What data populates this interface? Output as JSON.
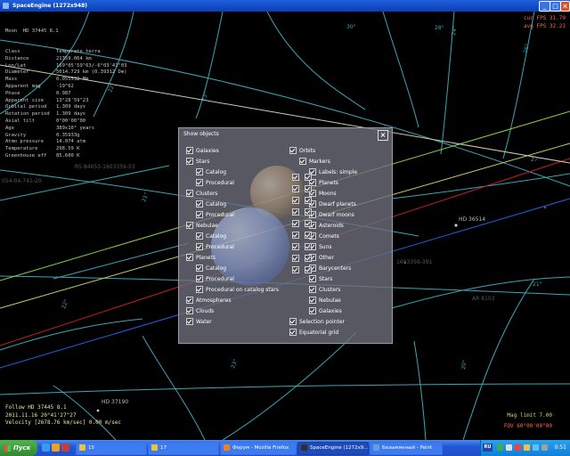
{
  "window": {
    "title": "SpaceEngine (1272x948)",
    "buttons": {
      "minimize": "_",
      "maximize": "□",
      "close": "×"
    }
  },
  "hud": {
    "object": "Moon  HD 37445 8.1",
    "rows": [
      {
        "label": "Class",
        "value": "Temperate terra"
      },
      {
        "label": "Distance",
        "value": "21359.064 km"
      },
      {
        "label": "Lon/Lat",
        "value": "169°05'59\"63/-6°03'41\"03"
      },
      {
        "label": "Diameter",
        "value": "5014.729 km (0.39312 D⊕)"
      },
      {
        "label": "Mass",
        "value": "0.055532 M⊕"
      },
      {
        "label": "Apparent mag",
        "value": "-19^62"
      },
      {
        "label": "Phase",
        "value": "0.987"
      },
      {
        "label": "Apparent size",
        "value": "13°28'59\"23"
      },
      {
        "label": "Orbital period",
        "value": "1.309 days"
      },
      {
        "label": "Rotation period",
        "value": "1.309 days"
      },
      {
        "label": "Axial tilt",
        "value": "0°00'00\"00"
      },
      {
        "label": "Age",
        "value": "389x10⁶ years"
      },
      {
        "label": "Gravity",
        "value": "0.35933g"
      },
      {
        "label": "Atmo pressure",
        "value": "14.074 atm"
      },
      {
        "label": "Temperature",
        "value": "298.59 K"
      },
      {
        "label": "Greenhouse eff",
        "value": "85.600 K"
      }
    ],
    "fps": {
      "cur": "cur FPS 31.79",
      "avg": "avg FPS 32.23"
    },
    "follow": [
      "Follow  HD 37445 8.1",
      "2011.11.16  20°41'27\"27",
      "Velocity [2678.76 km/sec] 0.00 m/sec"
    ],
    "mag_limit": "Mag limit  7.00",
    "fov": "FOV  60°00'00\"00"
  },
  "grid_labels": [
    "30°",
    "22°",
    "23°",
    "24°",
    "26°",
    "27°",
    "28°",
    "21°",
    "22°",
    "23°",
    "20°",
    "21°"
  ],
  "star_labels": {
    "hd36514": "HD 36514",
    "hd37190": "HD 37190",
    "faint1": "RS 84053-1603359-53",
    "faint2": "054-04-741-20",
    "faint3": "1603359-391",
    "faint4": "AR 8103"
  },
  "dialog": {
    "title": "Show objects",
    "close": "×",
    "left": [
      {
        "text": "Galaxies",
        "checked": true,
        "indent": 0
      },
      {
        "text": "Stars",
        "checked": true,
        "indent": 0
      },
      {
        "text": "Catalog",
        "checked": true,
        "indent": 1
      },
      {
        "text": "Procedural",
        "checked": true,
        "indent": 1
      },
      {
        "text": "Clusters",
        "checked": true,
        "indent": 0
      },
      {
        "text": "Catalog",
        "checked": true,
        "indent": 1
      },
      {
        "text": "Procedural",
        "checked": true,
        "indent": 1
      },
      {
        "text": "Nebulae",
        "checked": true,
        "indent": 0
      },
      {
        "text": "Catalog",
        "checked": true,
        "indent": 1
      },
      {
        "text": "Procedural",
        "checked": true,
        "indent": 1
      },
      {
        "text": "Planets",
        "checked": true,
        "indent": 0
      },
      {
        "text": "Catalog",
        "checked": true,
        "indent": 1
      },
      {
        "text": "Procedural",
        "checked": true,
        "indent": 1
      },
      {
        "text": "Procedural on catalog stars",
        "checked": true,
        "indent": 1
      },
      {
        "text": "Atmospheres",
        "checked": true,
        "indent": 0
      },
      {
        "text": "Clouds",
        "checked": true,
        "indent": 0
      },
      {
        "text": "Water",
        "checked": true,
        "indent": 0
      }
    ],
    "right": [
      {
        "text": "Orbits",
        "checked": true,
        "indent": 0
      },
      {
        "text": "Markers",
        "checked": true,
        "indent": 1
      },
      {
        "text": "Labels: simple",
        "checked": true,
        "indent": 2
      },
      {
        "text": "Planets",
        "checked": true,
        "indent": 2
      },
      {
        "text": "Moons",
        "checked": true,
        "indent": 2
      },
      {
        "text": "Dwarf planets",
        "checked": true,
        "indent": 2
      },
      {
        "text": "Dwarf moons",
        "checked": true,
        "indent": 2
      },
      {
        "text": "Asteroids",
        "checked": true,
        "indent": 2
      },
      {
        "text": "Comets",
        "checked": true,
        "indent": 2
      },
      {
        "text": "Suns",
        "checked": true,
        "indent": 2
      },
      {
        "text": "Other",
        "checked": true,
        "indent": 2
      },
      {
        "text": "Barycenters",
        "checked": true,
        "indent": 2
      },
      {
        "text": "Stars",
        "checked": true,
        "indent": 2
      },
      {
        "text": "Clusters",
        "checked": true,
        "indent": 2
      },
      {
        "text": "Nebulae",
        "checked": true,
        "indent": 2
      },
      {
        "text": "Galaxies",
        "checked": true,
        "indent": 2
      },
      {
        "text": "Selection pointer",
        "checked": true,
        "indent": 0
      },
      {
        "text": "Equatorial grid",
        "checked": true,
        "indent": 0
      }
    ]
  },
  "taskbar": {
    "start": "Пуск",
    "tasks": [
      {
        "label": "15",
        "active": false,
        "icon_color": "#f0c040"
      },
      {
        "label": "17",
        "active": false,
        "icon_color": "#f0c040"
      },
      {
        "label": "Форум - Mozilla Firefox",
        "active": false,
        "icon_color": "#f08020"
      },
      {
        "label": "SpaceEngine (1272x9...",
        "active": true,
        "icon_color": "#303030"
      },
      {
        "label": "Безымянный - Paint",
        "active": false,
        "icon_color": "#60a0e0"
      }
    ],
    "lang": "RU",
    "clock": "0:51"
  }
}
